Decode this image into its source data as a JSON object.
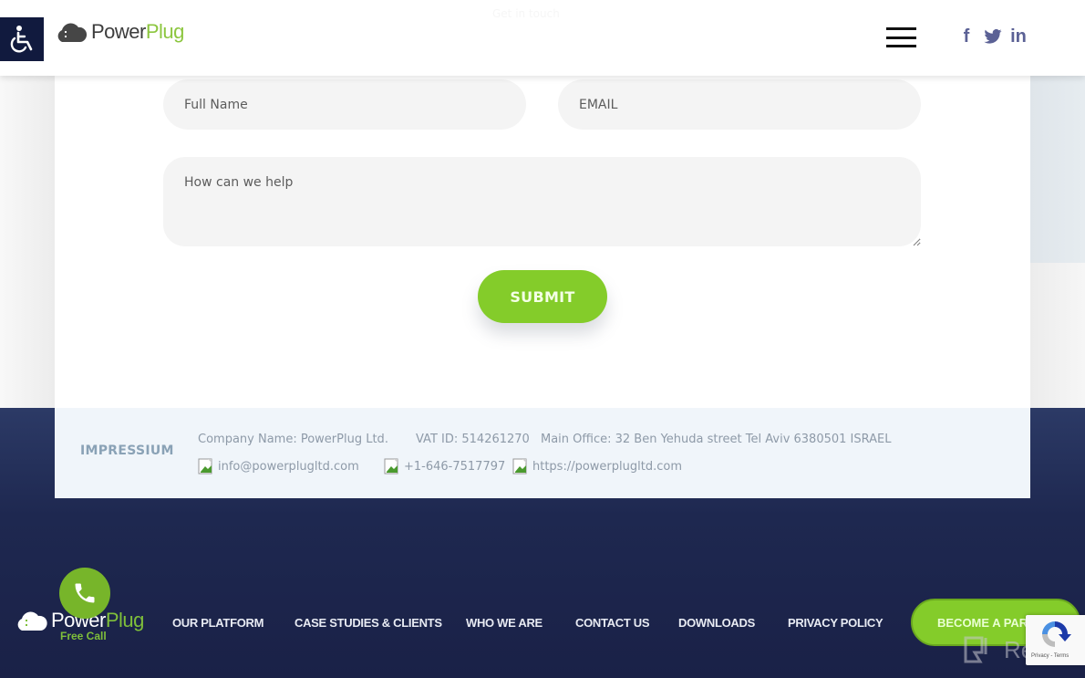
{
  "header": {
    "accessibility_label": "Accessibility",
    "logo": {
      "power": "Power",
      "plug": "Plug"
    },
    "ghost_title": "Get in touch",
    "menu_label": "Menu",
    "social": {
      "facebook": "f",
      "twitter": "twitter",
      "linkedin": "in"
    }
  },
  "form": {
    "name_placeholder": "Full Name",
    "email_placeholder": "EMAIL",
    "message_placeholder": "How can we help",
    "submit_label": "SUBMIT"
  },
  "impressium": {
    "title": "IMPRESSIUM",
    "company": "Company Name: PowerPlug  Ltd.",
    "vat": "VAT ID: 514261270",
    "office": "Main Office: 32 Ben Yehuda street Tel Aviv 6380501 ISRAEL",
    "email": "info@powerplugltd.com",
    "phone": "+1-646-7517797",
    "website": "https://powerplugltd.com"
  },
  "footer": {
    "logo": {
      "power": "Power",
      "plug": "Plug"
    },
    "free_call": "Free Call",
    "nav": [
      "OUR PLATFORM",
      "CASE STUDIES & CLIENTS",
      "WHO WE ARE",
      "CONTACT US",
      "DOWNLOADS",
      "PRIVACY POLICY"
    ],
    "cta_label": "BECOME A PARTNER",
    "watermark": "Revain",
    "recaptcha_terms": "Privacy - Terms"
  },
  "colors": {
    "brand_green": "#84cc2a",
    "navy": "#1e2850",
    "a11y_bg": "#111a3e"
  }
}
